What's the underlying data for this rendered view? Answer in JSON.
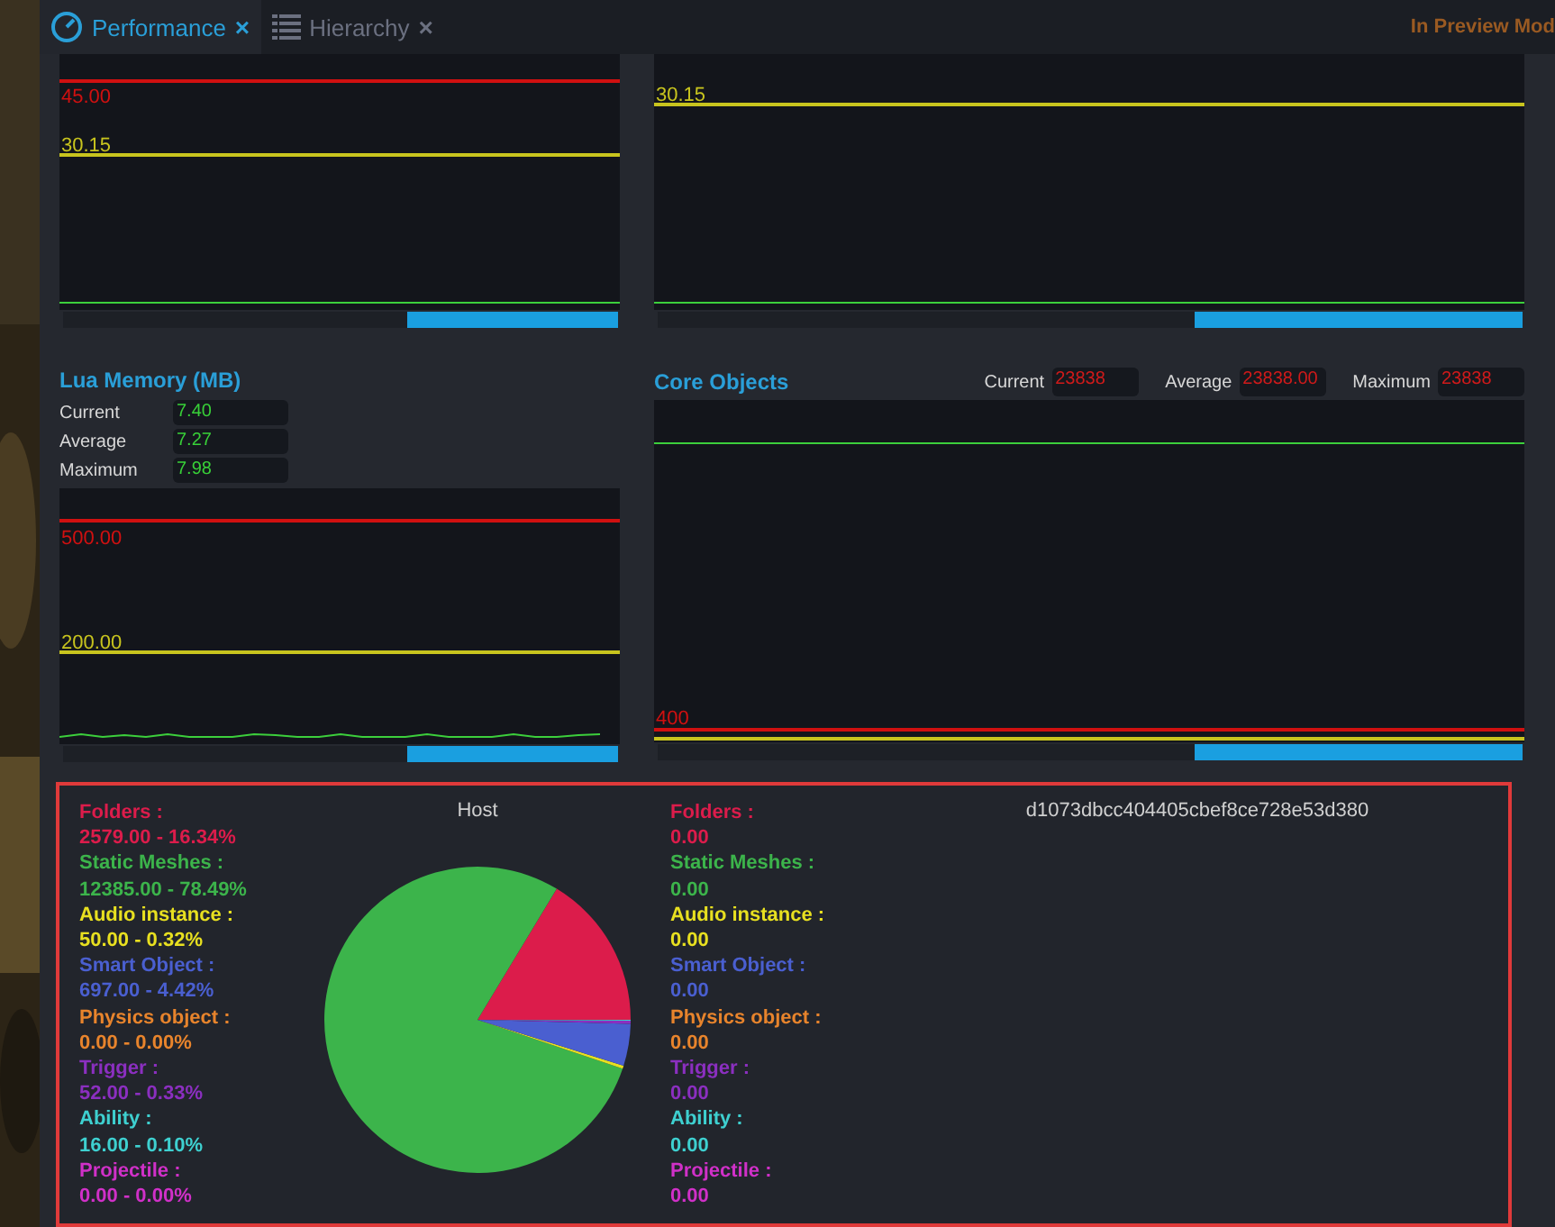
{
  "tabs": [
    {
      "label": "Performance",
      "selected": true,
      "close": "×"
    },
    {
      "label": "Hierarchy",
      "selected": false,
      "close": "×"
    }
  ],
  "mode_label": "In Preview Mod",
  "top_charts": [
    {
      "thresholds": [
        {
          "label": "45.00",
          "color": "#d01010"
        },
        {
          "label": "30.15",
          "color": "#c8c41e"
        }
      ]
    },
    {
      "thresholds": [
        {
          "label": "30.15",
          "color": "#c8c41e"
        }
      ]
    }
  ],
  "lua_memory": {
    "title": "Lua Memory (MB)",
    "stats": [
      {
        "label": "Current",
        "value": "7.40"
      },
      {
        "label": "Average",
        "value": "7.27"
      },
      {
        "label": "Maximum",
        "value": "7.98"
      }
    ],
    "thresholds": [
      {
        "label": "500.00",
        "color": "#d01010"
      },
      {
        "label": "200.00",
        "color": "#c8c41e"
      }
    ]
  },
  "core_objects": {
    "title": "Core Objects",
    "stats": [
      {
        "label": "Current",
        "value": "23838"
      },
      {
        "label": "Average",
        "value": "23838.00"
      },
      {
        "label": "Maximum",
        "value": "23838"
      }
    ],
    "thresholds": [
      {
        "label": "400",
        "color": "#d01010"
      },
      {
        "color": "#c8c41e"
      }
    ]
  },
  "breakdown": [
    {
      "title": "Host",
      "items": [
        {
          "label": "Folders :",
          "value": "2579.00 - 16.34%",
          "color": "#dc1c4b"
        },
        {
          "label": "Static Meshes :",
          "value": "12385.00 - 78.49%",
          "color": "#3cb44b"
        },
        {
          "label": "Audio instance :",
          "value": "50.00 - 0.32%",
          "color": "#e8e020"
        },
        {
          "label": "Smart Object :",
          "value": "697.00 - 4.42%",
          "color": "#4a5fd0"
        },
        {
          "label": "Physics object :",
          "value": "0.00 - 0.00%",
          "color": "#e8842c"
        },
        {
          "label": "Trigger :",
          "value": "52.00 - 0.33%",
          "color": "#8b2fc0"
        },
        {
          "label": "Ability :",
          "value": "16.00 - 0.10%",
          "color": "#3ed0d0"
        },
        {
          "label": "Projectile :",
          "value": "0.00 - 0.00%",
          "color": "#d030c8"
        }
      ],
      "chart_data": {
        "type": "pie",
        "values": [
          16.34,
          78.49,
          0.32,
          4.42,
          0,
          0.33,
          0.1,
          0
        ]
      }
    },
    {
      "title": "d1073dbcc404405cbef8ce728e53d380",
      "items": [
        {
          "label": "Folders :",
          "value": "0.00",
          "color": "#dc1c4b"
        },
        {
          "label": "Static Meshes :",
          "value": "0.00",
          "color": "#3cb44b"
        },
        {
          "label": "Audio instance :",
          "value": "0.00",
          "color": "#e8e020"
        },
        {
          "label": "Smart Object :",
          "value": "0.00",
          "color": "#4a5fd0"
        },
        {
          "label": "Physics object :",
          "value": "0.00",
          "color": "#e8842c"
        },
        {
          "label": "Trigger :",
          "value": "0.00",
          "color": "#8b2fc0"
        },
        {
          "label": "Ability :",
          "value": "0.00",
          "color": "#3ed0d0"
        },
        {
          "label": "Projectile :",
          "value": "0.00",
          "color": "#d030c8"
        }
      ]
    }
  ]
}
